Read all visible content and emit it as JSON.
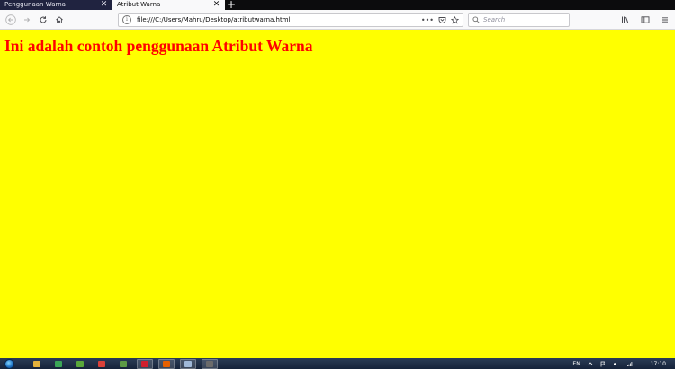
{
  "browser": {
    "tabs": [
      {
        "title": "Penggunaan Warna",
        "active": false
      },
      {
        "title": "Atribut Warna",
        "active": true
      }
    ],
    "new_tab_label": "+",
    "tab_close_label": "✕",
    "url": "file:///C:/Users/Mahru/Desktop/atributwarna.html",
    "search_placeholder": "Search",
    "page_actions_more": "•••",
    "info_label": "i"
  },
  "page": {
    "heading": "Ini adalah contoh penggunaan Atribut Warna",
    "background_color": "#ffff00",
    "heading_color": "#ff0000"
  },
  "taskbar": {
    "language": "EN",
    "time": "17:10",
    "icons": [
      {
        "name": "explorer-icon",
        "color": "#e3b13c",
        "open": false
      },
      {
        "name": "chrome-icon",
        "color": "#3aa657",
        "open": false
      },
      {
        "name": "app-green-icon",
        "color": "#59a83a",
        "open": false
      },
      {
        "name": "app-red-icon",
        "color": "#d9413a",
        "open": false
      },
      {
        "name": "app-notepad-icon",
        "color": "#5c9a46",
        "open": false
      },
      {
        "name": "opera-icon",
        "color": "#d01f2e",
        "open": true
      },
      {
        "name": "firefox-icon",
        "color": "#e66000",
        "open": true
      },
      {
        "name": "app-window-icon",
        "color": "#9fb8d8",
        "open": true
      },
      {
        "name": "app-film-icon",
        "color": "#6b6b6b",
        "open": true
      }
    ]
  }
}
